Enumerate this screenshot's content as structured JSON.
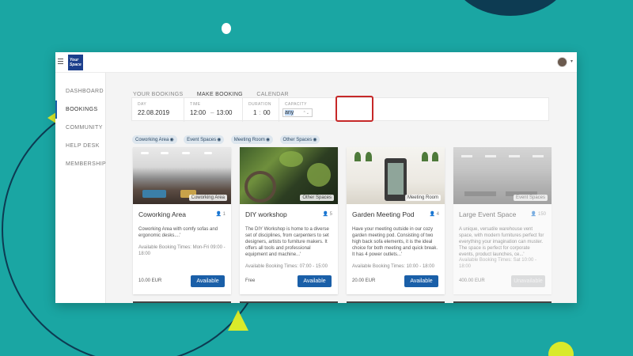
{
  "nav": {
    "items": [
      {
        "label": "DASHBOARD",
        "active": false
      },
      {
        "label": "BOOKINGS",
        "active": true
      },
      {
        "label": "COMMUNITY",
        "active": false
      },
      {
        "label": "HELP DESK",
        "active": false
      },
      {
        "label": "MEMBERSHIP",
        "active": false
      }
    ]
  },
  "logo": {
    "text": "Your Space"
  },
  "tabs": [
    {
      "label": "YOUR BOOKINGS",
      "active": false
    },
    {
      "label": "MAKE BOOKING",
      "active": true
    },
    {
      "label": "CALENDAR",
      "active": false
    }
  ],
  "filters": {
    "day": {
      "label": "DAY",
      "value": "22.08.2019"
    },
    "time": {
      "label": "TIME",
      "from": "12:00",
      "to": "13:00"
    },
    "duration": {
      "label": "DURATION",
      "hours": "1",
      "minutes": "00"
    },
    "capacity": {
      "label": "CAPACITY",
      "value": "any"
    }
  },
  "chips": [
    "Coworking Area",
    "Event Spaces",
    "Meeting Room",
    "Other Spaces"
  ],
  "cards": [
    {
      "tag": "Coworking Area",
      "title": "Coworking Area",
      "capacity": "1",
      "description": "Coworking Area with comfy sofas and ergonomic desks....'",
      "times": "Available Booking Times: Mon-Fri 09:00 - 18:00",
      "price": "10.00 EUR",
      "button": "Available",
      "available": true
    },
    {
      "tag": "Other Spaces",
      "title": "DIY workshop",
      "capacity": "5",
      "description": "The DIY Workshop is home to a diverse set of disciplines, from carpenters to set designers, artists to furniture makers. It offers all tools and professional equipment and machine...'",
      "times": "Available Booking Times: 07:00 - 15:00",
      "price": "Free",
      "button": "Available",
      "available": true
    },
    {
      "tag": "Meeting Room",
      "title": "Garden Meeting Pod",
      "capacity": "4",
      "description": "Have your meeting outside in our cozy garden meeting pod. Consisting of two high back sofa elements, it is the ideal choice for both meeting and quick break. It has 4 power outlets...'",
      "times": "Available Booking Times: 10:00 - 18:00",
      "price": "20.00 EUR",
      "button": "Available",
      "available": true
    },
    {
      "tag": "Event Spaces",
      "title": "Large Event Space",
      "capacity": "150",
      "description": "A unique, versatile warehouse vent space, with modern furnitures perfect for everything your imagination can muster. The space is perfect for corporate events, product launches, ce...'",
      "times": "Available Booking Times: Sat 10:00 - 18:00",
      "price": "400.00 EUR",
      "button": "Unavailable",
      "available": false
    }
  ],
  "colors": {
    "background": "#1aa6a3",
    "accent": "#1a5fa8",
    "highlight": "#c62828",
    "deco_dark": "#0d3b52",
    "deco_lime": "#d9ea2a"
  }
}
